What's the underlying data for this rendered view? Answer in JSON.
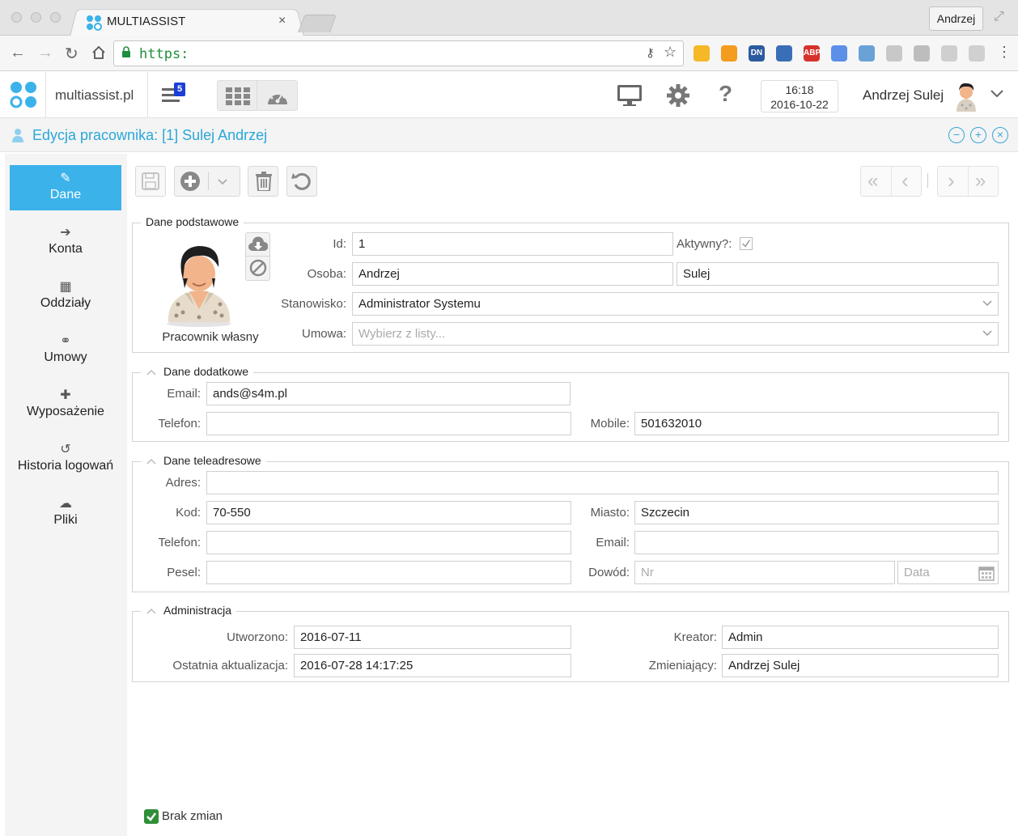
{
  "browser": {
    "tab_title": "MULTIASSIST",
    "tab_close": "×",
    "profile": "Andrzej",
    "url": "https:",
    "menu": "⋮",
    "extensions": [
      {
        "name": "bookmark-ext",
        "label": "",
        "color": "#f5b829"
      },
      {
        "name": "rss-ext",
        "label": "",
        "color": "#f39c1d"
      },
      {
        "name": "dn-ext",
        "label": "DN",
        "color": "#2c5aa0"
      },
      {
        "name": "globe-ext",
        "label": "",
        "color": "#3a6fb7"
      },
      {
        "name": "abp-ext",
        "label": "ABP",
        "color": "#d6322c"
      },
      {
        "name": "translate-ext",
        "label": "",
        "color": "#5b8fe8"
      },
      {
        "name": "screen-ext",
        "label": "",
        "color": "#6aa2d8"
      },
      {
        "name": "cube-ext",
        "label": "",
        "color": "#c8c8c8"
      },
      {
        "name": "drive-ext",
        "label": "",
        "color": "#bdbdbd"
      },
      {
        "name": "tc-ext",
        "label": "",
        "color": "#cfcfcf"
      },
      {
        "name": "grid-ext",
        "label": "",
        "color": "#d0d0d0"
      }
    ]
  },
  "header": {
    "domain": "multiassist.pl",
    "notifications": "5",
    "time": "16:18",
    "date": "2016-10-22",
    "user": "Andrzej Sulej",
    "help": "?"
  },
  "page": {
    "title": "Edycja pracownika: [1] Sulej Andrzej",
    "window_controls": [
      "−",
      "+",
      "×"
    ]
  },
  "sidebar": {
    "items": [
      {
        "label": "Dane",
        "icon": "✎"
      },
      {
        "label": "Konta",
        "icon": "➔"
      },
      {
        "label": "Oddziały",
        "icon": "▦"
      },
      {
        "label": "Umowy",
        "icon": "⚭"
      },
      {
        "label": "Wyposażenie",
        "icon": "✚"
      },
      {
        "label": "Historia logowań",
        "icon": "↺"
      },
      {
        "label": "Pliki",
        "icon": "☁"
      }
    ]
  },
  "pager": {
    "first": "«",
    "prev": "‹",
    "next": "›",
    "last": "»"
  },
  "basic": {
    "legend": "Dane podstawowe",
    "photo_caption": "Pracownik własny",
    "id_label": "Id:",
    "id_value": "1",
    "active_label": "Aktywny?:",
    "active_checked": true,
    "person_label": "Osoba:",
    "first_name": "Andrzej",
    "last_name": "Sulej",
    "position_label": "Stanowisko:",
    "position_value": "Administrator Systemu",
    "contract_label": "Umowa:",
    "contract_placeholder": "Wybierz z listy..."
  },
  "extra": {
    "legend": "Dane dodatkowe",
    "email_label": "Email:",
    "email_value": "ands@s4m.pl",
    "phone_label": "Telefon:",
    "phone_value": "",
    "mobile_label": "Mobile:",
    "mobile_value": "501632010"
  },
  "address": {
    "legend": "Dane teleadresowe",
    "address_label": "Adres:",
    "address_value": "",
    "zip_label": "Kod:",
    "zip_value": "70-550",
    "city_label": "Miasto:",
    "city_value": "Szczecin",
    "phone_label": "Telefon:",
    "phone_value": "",
    "email_label": "Email:",
    "email_value": "",
    "pesel_label": "Pesel:",
    "pesel_value": "",
    "id_doc_label": "Dowód:",
    "id_doc_placeholder": "Nr",
    "date_placeholder": "Data"
  },
  "admin": {
    "legend": "Administracja",
    "created_label": "Utworzono:",
    "created_value": "2016-07-11",
    "creator_label": "Kreator:",
    "creator_value": "Admin",
    "updated_label": "Ostatnia aktualizacja:",
    "updated_value": "2016-07-28 14:17:25",
    "modifier_label": "Zmieniający:",
    "modifier_value": "Andrzej Sulej"
  },
  "status": {
    "label": "Brak zmian"
  },
  "colors": {
    "accent": "#3bb2ea",
    "title": "#2aa7d9",
    "ok": "#2f8f38"
  }
}
